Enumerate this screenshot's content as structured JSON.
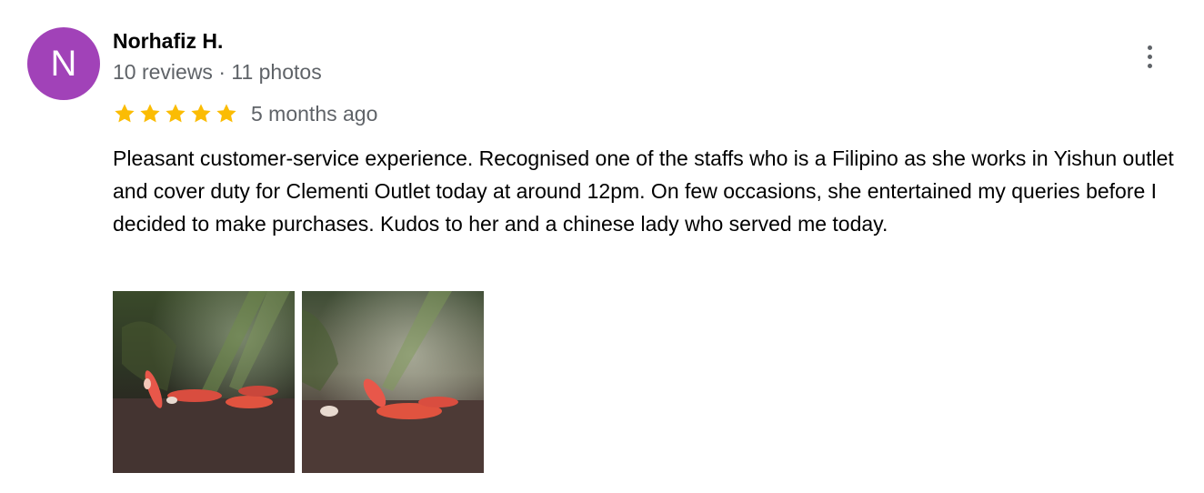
{
  "review": {
    "author": {
      "initial": "N",
      "name": "Norhafiz H.",
      "meta": "10 reviews · 11 photos",
      "avatar_color": "#a142b8"
    },
    "rating": {
      "stars": 5,
      "max": 5,
      "star_color": "#fbbc04"
    },
    "date": "5 months ago",
    "text": "Pleasant customer-service experience. Recognised one of the staffs who is a Filipino as she works in Yishun outlet and cover duty for Clementi Outlet today at around 12pm. On few occasions, she entertained my queries before I decided to make purchases. Kudos to her and a chinese lady who served me today.",
    "more_icon": "more-vert-icon",
    "photos": [
      {
        "subject": "red shrimp in aquarium",
        "icon": "photo-thumbnail"
      },
      {
        "subject": "red shrimp in aquarium",
        "icon": "photo-thumbnail"
      }
    ]
  }
}
